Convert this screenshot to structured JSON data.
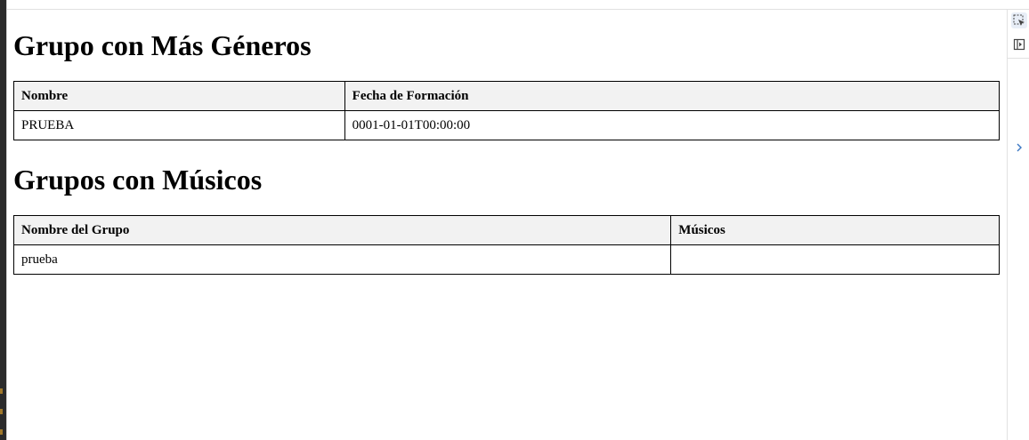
{
  "section_genres": {
    "title": "Grupo con Más Géneros",
    "headers": [
      "Nombre",
      "Fecha de Formación"
    ],
    "rows": [
      [
        "PRUEBA",
        "0001-01-01T00:00:00"
      ]
    ]
  },
  "section_musicians": {
    "title": "Grupos con Músicos",
    "headers": [
      "Nombre del Grupo",
      "Músicos"
    ],
    "rows": [
      [
        "prueba",
        ""
      ]
    ]
  },
  "side_panel": {
    "icons": [
      "select-element-icon",
      "toggle-panel-icon",
      "chevron-right-icon"
    ]
  },
  "colors": {
    "header_bg": "#f2f2f2",
    "border": "#000000",
    "chevron": "#3b78c4"
  }
}
